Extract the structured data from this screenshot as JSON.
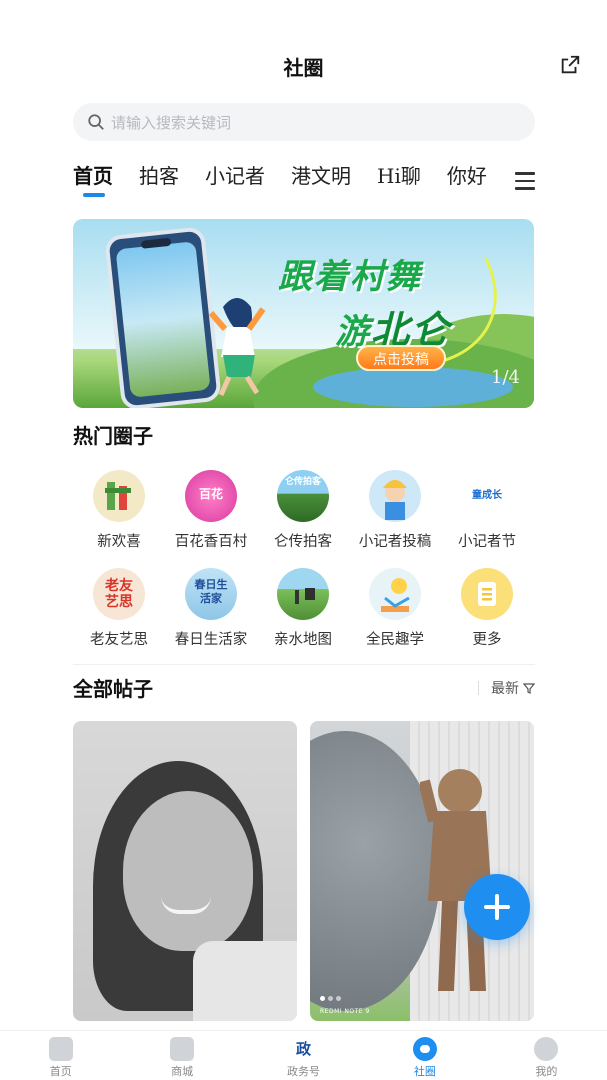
{
  "header": {
    "title": "社圈",
    "share_icon": "external-share-icon"
  },
  "search": {
    "placeholder": "请输入搜索关键词"
  },
  "tabs": [
    {
      "label": "首页",
      "active": true
    },
    {
      "label": "拍客",
      "active": false
    },
    {
      "label": "小记者",
      "active": false
    },
    {
      "label": "港文明",
      "active": false
    },
    {
      "label": "Hi聊",
      "active": false
    },
    {
      "label": "你好",
      "active": false
    }
  ],
  "banner": {
    "headline_line1": "跟着村舞",
    "headline_line2_prefix": "游",
    "headline_line2_emphasis": "北仑",
    "cta": "点击投稿",
    "pager": "1/4"
  },
  "hot_circles": {
    "title": "热门圈子",
    "items": [
      {
        "label": "新欢喜",
        "badge": "",
        "color": "#f3e9c7"
      },
      {
        "label": "百花香百村",
        "badge": "百花",
        "color": "#e64fb0"
      },
      {
        "label": "仑传拍客",
        "badge": "仑传拍客",
        "color": "#4a8f3a"
      },
      {
        "label": "小记者投稿",
        "badge": "",
        "color": "#f6d34a"
      },
      {
        "label": "小记者节",
        "badge": "童成长",
        "color": "#ffffff"
      },
      {
        "label": "老友艺思",
        "badge": "老友艺思",
        "color": "#f7e6d6"
      },
      {
        "label": "春日生活家",
        "badge": "春日生活家",
        "color": "#8fc6e6"
      },
      {
        "label": "亲水地图",
        "badge": "",
        "color": "#7bbf5a"
      },
      {
        "label": "全民趣学",
        "badge": "",
        "color": "#e8f3f8"
      },
      {
        "label": "更多",
        "badge": "",
        "color": "#fbe07a"
      }
    ]
  },
  "posts": {
    "title": "全部帖子",
    "sort_label": "最新",
    "card2_watermark": "REDMI NOTE 9"
  },
  "bottom_nav": [
    {
      "label": "首页",
      "active": false
    },
    {
      "label": "商城",
      "active": false
    },
    {
      "label": "政务号",
      "active": false,
      "glyph": "政"
    },
    {
      "label": "社圈",
      "active": true
    },
    {
      "label": "我的",
      "active": false
    }
  ],
  "colors": {
    "accent": "#1e88e5",
    "fab": "#1e8ff0"
  }
}
